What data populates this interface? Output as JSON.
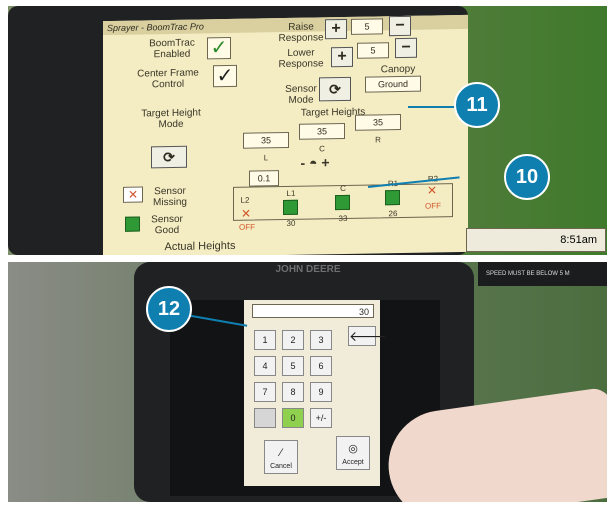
{
  "top": {
    "app_title": "Sprayer - BoomTrac Pro",
    "boomtrac_enabled_label": "BoomTrac Enabled",
    "center_frame_label": "Center Frame Control",
    "raise_label": "Raise Response",
    "raise_value": "5",
    "lower_label": "Lower Response",
    "lower_value": "5",
    "sensor_mode_label": "Sensor Mode",
    "canopy_label": "Canopy",
    "ground_label": "Ground",
    "target_height_mode_label": "Target Height Mode",
    "target_heights_label": "Target Heights",
    "target_l": "35",
    "target_c": "35",
    "target_r": "35",
    "l_label": "L",
    "c_label": "C",
    "r_label": "R",
    "tilt_value": "0.1",
    "sensor_missing_label": "Sensor Missing",
    "sensor_good_label": "Sensor Good",
    "sensors": [
      {
        "name": "L2",
        "value": "OFF"
      },
      {
        "name": "L1",
        "value": "30"
      },
      {
        "name": "C",
        "value": "33"
      },
      {
        "name": "R1",
        "value": "26"
      },
      {
        "name": "R2",
        "value": "OFF"
      }
    ],
    "actual_heights_label": "Actual Heights",
    "time": "8:51am",
    "callout_10": "10",
    "callout_11": "11"
  },
  "bottom": {
    "brand": "JOHN DEERE",
    "sticker_text": "SPEED MUST BE BELOW 5 M",
    "entry_value": "30",
    "keys": [
      "1",
      "2",
      "3",
      "4",
      "5",
      "6",
      "7",
      "8",
      "9",
      "0",
      "+/-"
    ],
    "cancel_label": "Cancel",
    "accept_label": "Accept",
    "callout_12": "12"
  }
}
